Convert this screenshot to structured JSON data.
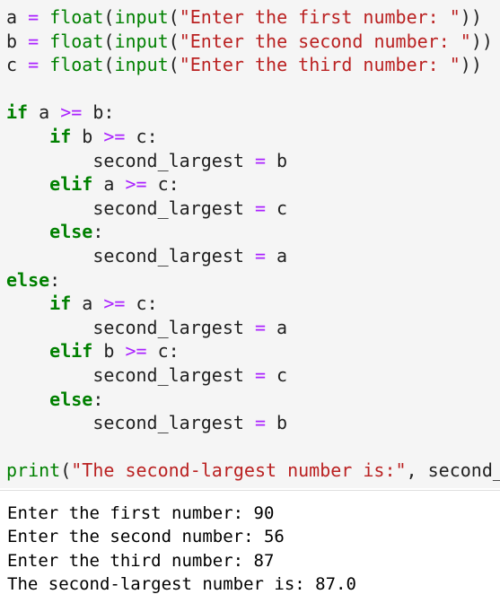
{
  "code_cell": {
    "lines": [
      [
        {
          "t": "a",
          "c": "pl"
        },
        {
          "t": " ",
          "c": "pl"
        },
        {
          "t": "=",
          "c": "op"
        },
        {
          "t": " ",
          "c": "pl"
        },
        {
          "t": "float",
          "c": "bi"
        },
        {
          "t": "(",
          "c": "pl"
        },
        {
          "t": "input",
          "c": "bi"
        },
        {
          "t": "(",
          "c": "pl"
        },
        {
          "t": "\"Enter the first number: \"",
          "c": "st"
        },
        {
          "t": "))",
          "c": "pl"
        }
      ],
      [
        {
          "t": "b",
          "c": "pl"
        },
        {
          "t": " ",
          "c": "pl"
        },
        {
          "t": "=",
          "c": "op"
        },
        {
          "t": " ",
          "c": "pl"
        },
        {
          "t": "float",
          "c": "bi"
        },
        {
          "t": "(",
          "c": "pl"
        },
        {
          "t": "input",
          "c": "bi"
        },
        {
          "t": "(",
          "c": "pl"
        },
        {
          "t": "\"Enter the second number: \"",
          "c": "st"
        },
        {
          "t": "))",
          "c": "pl"
        }
      ],
      [
        {
          "t": "c",
          "c": "pl"
        },
        {
          "t": " ",
          "c": "pl"
        },
        {
          "t": "=",
          "c": "op"
        },
        {
          "t": " ",
          "c": "pl"
        },
        {
          "t": "float",
          "c": "bi"
        },
        {
          "t": "(",
          "c": "pl"
        },
        {
          "t": "input",
          "c": "bi"
        },
        {
          "t": "(",
          "c": "pl"
        },
        {
          "t": "\"Enter the third number: \"",
          "c": "st"
        },
        {
          "t": "))",
          "c": "pl"
        }
      ],
      [],
      [
        {
          "t": "if",
          "c": "kw"
        },
        {
          "t": " a ",
          "c": "pl"
        },
        {
          "t": ">=",
          "c": "op"
        },
        {
          "t": " b:",
          "c": "pl"
        }
      ],
      [
        {
          "t": "    ",
          "c": "pl"
        },
        {
          "t": "if",
          "c": "kw"
        },
        {
          "t": " b ",
          "c": "pl"
        },
        {
          "t": ">=",
          "c": "op"
        },
        {
          "t": " c:",
          "c": "pl"
        }
      ],
      [
        {
          "t": "        second_largest ",
          "c": "pl"
        },
        {
          "t": "=",
          "c": "op"
        },
        {
          "t": " b",
          "c": "pl"
        }
      ],
      [
        {
          "t": "    ",
          "c": "pl"
        },
        {
          "t": "elif",
          "c": "kw"
        },
        {
          "t": " a ",
          "c": "pl"
        },
        {
          "t": ">=",
          "c": "op"
        },
        {
          "t": " c:",
          "c": "pl"
        }
      ],
      [
        {
          "t": "        second_largest ",
          "c": "pl"
        },
        {
          "t": "=",
          "c": "op"
        },
        {
          "t": " c",
          "c": "pl"
        }
      ],
      [
        {
          "t": "    ",
          "c": "pl"
        },
        {
          "t": "else",
          "c": "kw"
        },
        {
          "t": ":",
          "c": "pl"
        }
      ],
      [
        {
          "t": "        second_largest ",
          "c": "pl"
        },
        {
          "t": "=",
          "c": "op"
        },
        {
          "t": " a",
          "c": "pl"
        }
      ],
      [
        {
          "t": "else",
          "c": "kw"
        },
        {
          "t": ":",
          "c": "pl"
        }
      ],
      [
        {
          "t": "    ",
          "c": "pl"
        },
        {
          "t": "if",
          "c": "kw"
        },
        {
          "t": " a ",
          "c": "pl"
        },
        {
          "t": ">=",
          "c": "op"
        },
        {
          "t": " c:",
          "c": "pl"
        }
      ],
      [
        {
          "t": "        second_largest ",
          "c": "pl"
        },
        {
          "t": "=",
          "c": "op"
        },
        {
          "t": " a",
          "c": "pl"
        }
      ],
      [
        {
          "t": "    ",
          "c": "pl"
        },
        {
          "t": "elif",
          "c": "kw"
        },
        {
          "t": " b ",
          "c": "pl"
        },
        {
          "t": ">=",
          "c": "op"
        },
        {
          "t": " c:",
          "c": "pl"
        }
      ],
      [
        {
          "t": "        second_largest ",
          "c": "pl"
        },
        {
          "t": "=",
          "c": "op"
        },
        {
          "t": " c",
          "c": "pl"
        }
      ],
      [
        {
          "t": "    ",
          "c": "pl"
        },
        {
          "t": "else",
          "c": "kw"
        },
        {
          "t": ":",
          "c": "pl"
        }
      ],
      [
        {
          "t": "        second_largest ",
          "c": "pl"
        },
        {
          "t": "=",
          "c": "op"
        },
        {
          "t": " b",
          "c": "pl"
        }
      ],
      [],
      [
        {
          "t": "print",
          "c": "bi"
        },
        {
          "t": "(",
          "c": "pl"
        },
        {
          "t": "\"The second-largest number is:\"",
          "c": "st"
        },
        {
          "t": ", second_",
          "c": "pl"
        }
      ]
    ]
  },
  "output": {
    "lines": [
      "Enter the first number: 90",
      "Enter the second number: 56",
      "Enter the third number: 87",
      "The second-largest number is: 87.0"
    ]
  },
  "colors": {
    "keyword": "#008000",
    "builtin": "#008000",
    "string": "#ba2121",
    "operator": "#aa22ff",
    "text": "#212121",
    "code_background": "#f5f5f5",
    "output_background": "#ffffff"
  }
}
